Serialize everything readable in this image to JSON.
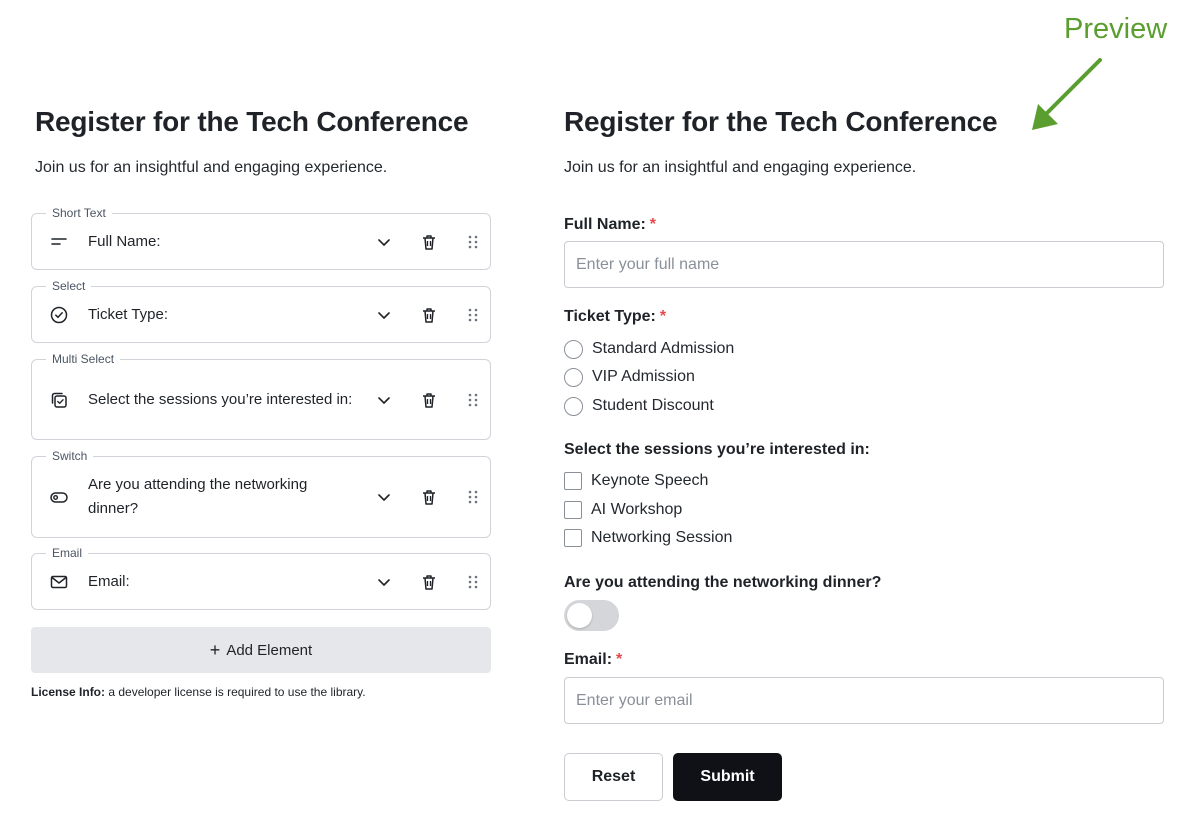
{
  "builder": {
    "title": "Register for the Tech Conference",
    "subtitle": "Join us for an insightful and engaging experience.",
    "fields": [
      {
        "type_label": "Short Text",
        "label": "Full Name:",
        "icon": "short-text-icon"
      },
      {
        "type_label": "Select",
        "label": "Ticket Type:",
        "icon": "circle-check-icon"
      },
      {
        "type_label": "Multi Select",
        "label": "Select the sessions you’re interested in:",
        "icon": "multi-select-icon"
      },
      {
        "type_label": "Switch",
        "label": "Are you attending the networking dinner?",
        "icon": "switch-icon"
      },
      {
        "type_label": "Email",
        "label": "Email:",
        "icon": "mail-icon"
      }
    ],
    "add_element_label": "Add Element",
    "license_bold": "License Info:",
    "license_text": " a developer license is required to use the library."
  },
  "annotation": {
    "preview_label": "Preview",
    "color": "#5a9e2f"
  },
  "preview": {
    "title": "Register for the Tech Conference",
    "subtitle": "Join us for an insightful and engaging experience.",
    "full_name": {
      "label": "Full Name:",
      "required": "*",
      "placeholder": "Enter your full name",
      "value": ""
    },
    "ticket_type": {
      "label": "Ticket Type:",
      "required": "*",
      "options": [
        "Standard Admission",
        "VIP Admission",
        "Student Discount"
      ],
      "selected": null
    },
    "sessions": {
      "label": "Select the sessions you’re interested in:",
      "options": [
        "Keynote Speech",
        "AI Workshop",
        "Networking Session"
      ],
      "checked": []
    },
    "dinner": {
      "label": "Are you attending the networking dinner?",
      "on": false
    },
    "email": {
      "label": "Email:",
      "required": "*",
      "placeholder": "Enter your email",
      "value": ""
    },
    "reset_label": "Reset",
    "submit_label": "Submit"
  },
  "colors": {
    "accent_green": "#5a9e2f",
    "required_red": "#e5484d",
    "submit_bg": "#0f1117",
    "add_button_bg": "#e5e7ea"
  }
}
